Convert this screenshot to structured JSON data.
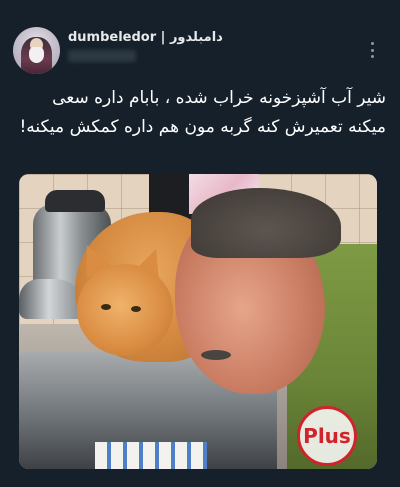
{
  "post": {
    "display_name": "dumbeledor | دامبلدور",
    "text": "شیر آب آشپزخونه خراب شده ، بابام داره سعی میکنه تعمیرش کنه گربه مون هم داره کمکش میکنه!",
    "watermark_text": "Plus",
    "more_icon": "more-vertical-icon",
    "colors": {
      "background": "#15202b",
      "text": "#ffffff",
      "muted": "#8b98a5"
    }
  }
}
